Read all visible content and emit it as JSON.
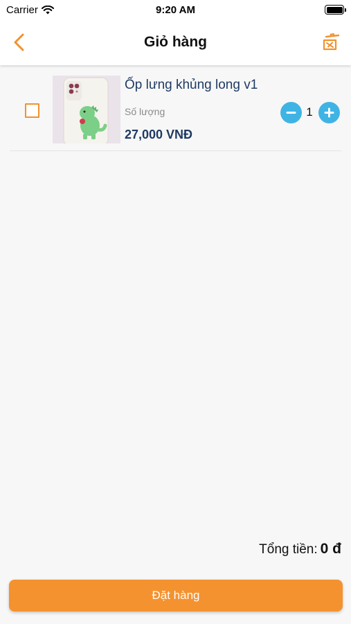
{
  "status_bar": {
    "carrier": "Carrier",
    "time": "9:20 AM",
    "wifi_icon": "wifi-icon",
    "battery_level": 1.0
  },
  "nav": {
    "title": "Giỏ hàng",
    "back_icon": "chevron-left-icon",
    "action_icon": "trash-icon"
  },
  "cart": {
    "items": [
      {
        "name": "Ốp lưng khủng long v1",
        "quantity_label": "Số lượng",
        "quantity": "1",
        "price": "27,000 VNĐ",
        "checked": false,
        "image_icon": "dinosaur-phone-case-image"
      }
    ]
  },
  "footer": {
    "total_label": "Tổng tiền:",
    "total_value": "0 đ",
    "order_button": "Đặt hàng"
  },
  "colors": {
    "accent": "#f4922f",
    "qty_button": "#3fb4e4",
    "product_text": "#1f3a63"
  }
}
